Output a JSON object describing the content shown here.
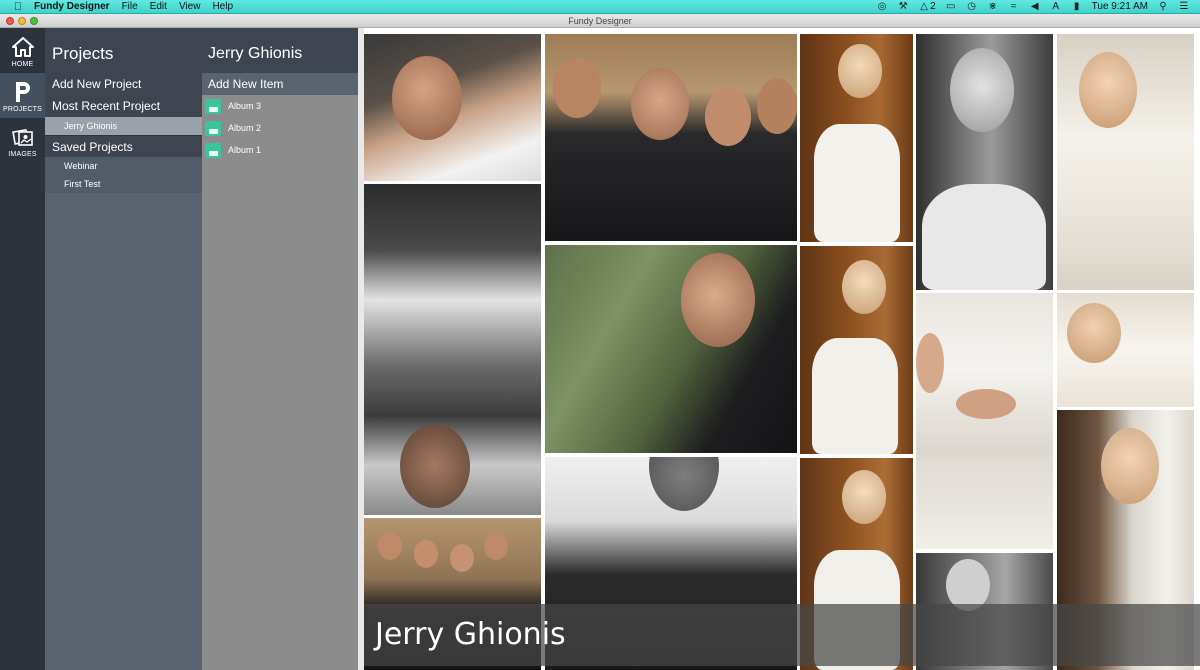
{
  "menubar": {
    "app_name": "Fundy Designer",
    "menus": [
      "File",
      "Edit",
      "View",
      "Help"
    ],
    "status_icons": [
      "ai-icon",
      "wrench-icon",
      "adobe-badge-icon",
      "airplay-icon",
      "time-machine-icon",
      "bluetooth-icon",
      "wifi-icon",
      "volume-icon",
      "keyboard-icon",
      "battery-icon"
    ],
    "adobe_badge_count": "2",
    "clock": "Tue 9:21 AM"
  },
  "window": {
    "title": "Fundy Designer"
  },
  "rail": {
    "home_label": "HOME",
    "projects_label": "PROJECTS",
    "images_label": "IMAGES"
  },
  "projects": {
    "title": "Projects",
    "add_new": "Add New Project",
    "most_recent": "Most Recent Project",
    "recent_items": [
      "Jerry Ghionis"
    ],
    "saved": "Saved Projects",
    "saved_items": [
      "Webinar",
      "First Test"
    ]
  },
  "items": {
    "title": "Jerry Ghionis",
    "add_new": "Add New Item",
    "albums": [
      "Album 3",
      "Album 2",
      "Album 1"
    ]
  },
  "gallery": {
    "caption": "Jerry Ghionis"
  },
  "colors": {
    "menubar": "#46d8d0",
    "rail": "#2d333d",
    "panel_dark": "#3e4551",
    "panel": "#5a6370",
    "items_bg": "#8c8c8c",
    "album_icon": "#3cc49a"
  }
}
